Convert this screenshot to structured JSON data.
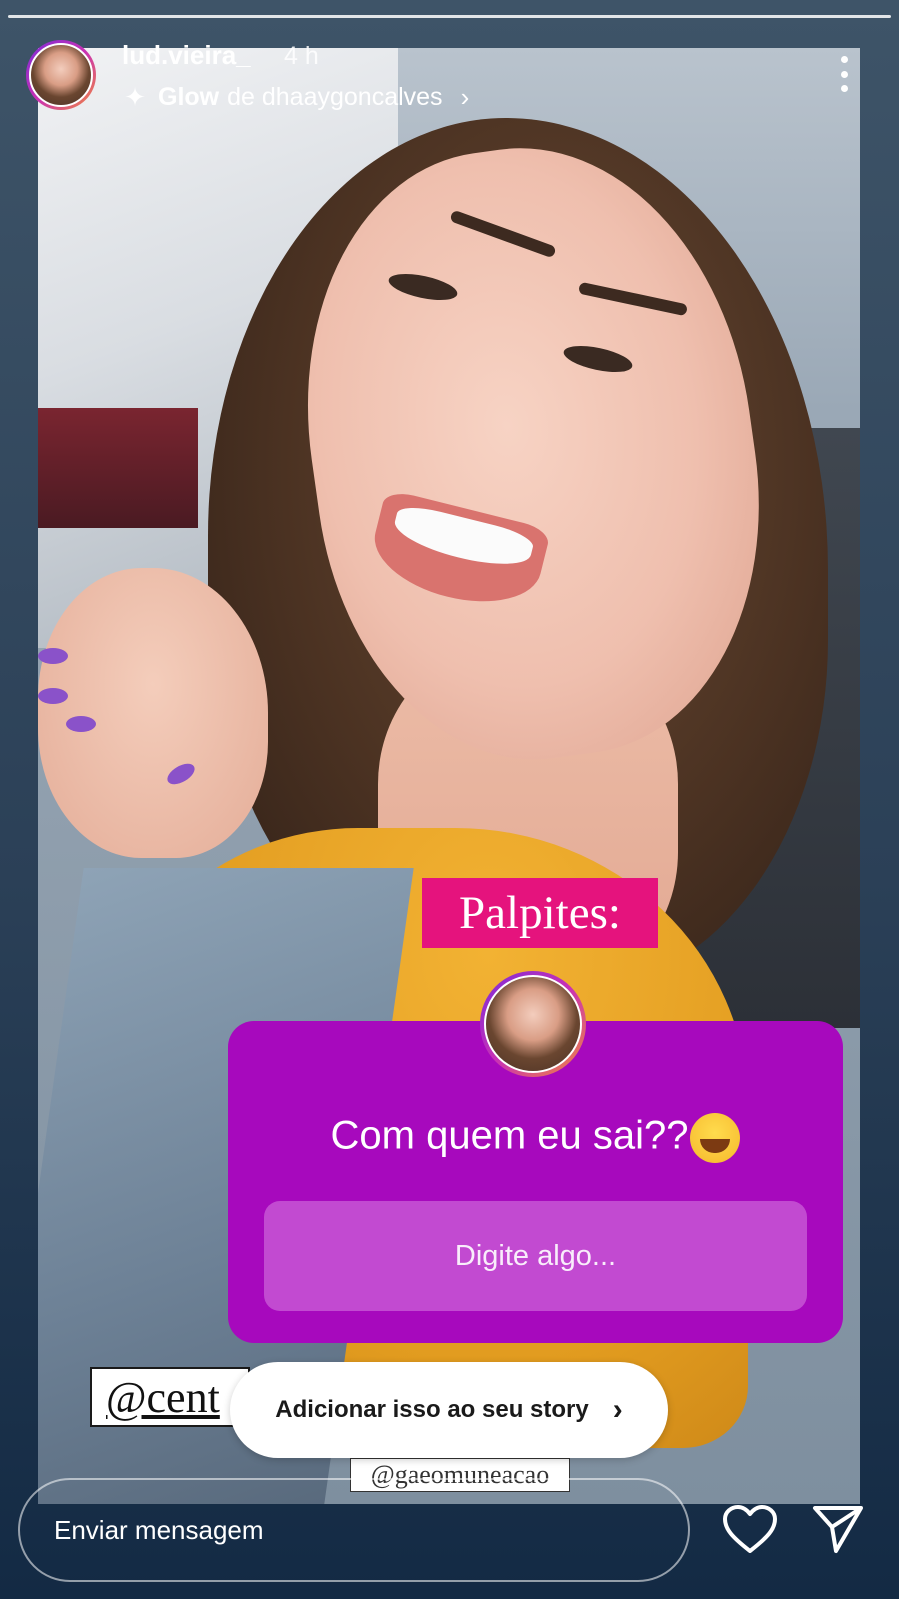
{
  "story": {
    "username": "lud.vieira_",
    "time_ago": "4 h",
    "glow_label": "Glow",
    "glow_by": "de dhaaygoncalves",
    "chevron": "›"
  },
  "stickers": {
    "palpites": "Palpites:",
    "question": "Com quem eu sai??",
    "question_emoji": "😅",
    "answer_placeholder": "Digite algo...",
    "mention_tag": "@cent",
    "small_tag": "@gaeomuneacao"
  },
  "add_to_story": {
    "label": "Adicionar isso ao seu story",
    "chevron": "›"
  },
  "reply_bar": {
    "placeholder": "Enviar mensagem"
  },
  "icons": {
    "sparkle": "✦",
    "heart": "heart-icon",
    "send": "send-icon",
    "more": "more-vertical-icon"
  },
  "colors": {
    "question_bg": "#a709bd",
    "answer_bg": "#c24ad1",
    "palpites_bg": "#e5137d",
    "shirt": "#e19b1f"
  }
}
